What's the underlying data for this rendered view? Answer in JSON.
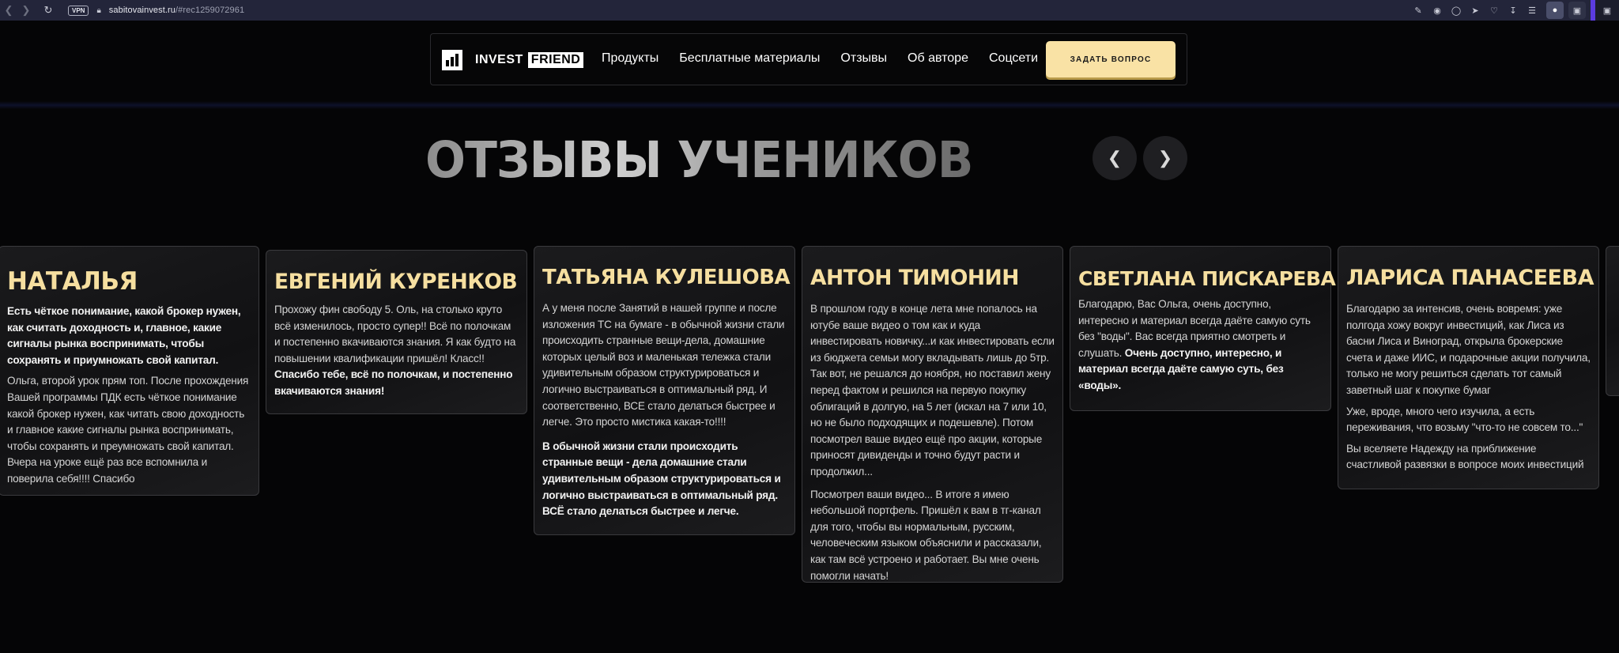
{
  "browser": {
    "vpn_label": "VPN",
    "url_host": "sabitovainvest.ru",
    "url_path": "/#rec1259072961"
  },
  "header": {
    "logo_text_1": "INVEST",
    "logo_text_2": "FRIEND",
    "nav": [
      "Продукты",
      "Бесплатные материалы",
      "Отзывы",
      "Об авторе",
      "Соцсети"
    ],
    "cta_label": "ЗАДАТЬ ВОПРОС"
  },
  "section": {
    "title": "ОТЗЫВЫ УЧЕНИКОВ"
  },
  "reviews": [
    {
      "name": "НАТАЛЬЯ",
      "paragraphs": [
        {
          "text": "Есть чёткое понимание, какой брокер нужен, как считать доходность и, главное, какие сигналы рынка воспринимать, чтобы сохранять и приумножать свой капитал.",
          "bold": true
        },
        {
          "text": "Ольга, второй урок прям топ. После прохождения Вашей программы ПДК есть чёткое понимание какой брокер нужен, как читать свою доходность и главное какие сигналы рынка воспринимать, чтобы сохранять и преумножать свой капитал. Вчера на уроке ещё раз все вспомнила и поверила себя!!!! Спасибо",
          "bold": false
        }
      ]
    },
    {
      "name": "ЕВГЕНИЙ КУРЕНКОВ",
      "paragraphs": [
        {
          "text": "Прохожу фин свободу 5. Оль, на столько круто всё изменилось, просто супер!! Всё по полочкам и постепенно вкачиваются знания. Я как будто на повышении квалификации пришёл! Класс!!",
          "bold": false
        },
        {
          "text": "Спасибо тебе, всё по полочкам, и постепенно вкачиваются знания!",
          "bold": true
        }
      ]
    },
    {
      "name": "ТАТЬЯНА КУЛЕШОВА",
      "paragraphs": [
        {
          "text": "А у меня после Занятий в нашей группе и после изложения ТС на бумаге - в обычной жизни стали происходить странные вещи-дела, домашние которых целый воз и маленькая тележка стали удивительным образом структурироваться и логично выстраиваться в оптимальный ряд. И соответственно, ВСЕ стало делаться быстрее и легче. Это просто мистика какая-то!!!!",
          "bold": false
        },
        {
          "text": "В обычной жизни стали происходить странные вещи - дела домашние стали удивительным образом структурироваться и логично выстраиваться в оптимальный ряд. ВСЁ стало делаться быстрее и легче.",
          "bold": true
        }
      ]
    },
    {
      "name": "АНТОН ТИМОНИН",
      "paragraphs": [
        {
          "text": "В прошлом году в конце лета мне попалось на ютубе ваше видео о том как и куда инвестировать новичку...и как инвестировать если из бюджета семьи могу вкладывать лишь до 5тр. Так вот, не решался до ноября, но поставил жену перед фактом и решился на первую покупку облигаций в долгую, на 5 лет (искал на 7 или 10, но не было подходящих и подешевле). Потом посмотрел ваше видео ещё про акции, которые приносят дивиденды и точно будут расти и продолжил...",
          "bold": false
        },
        {
          "text": "Посмотрел ваши видео... В итоге я имею небольшой портфель. Пришёл к вам в тг-канал для того, чтобы вы нормальным, русским, человеческим языком объяснили и рассказали, как там всё устроено и работает. Вы мне очень помогли начать!",
          "bold": false
        }
      ]
    },
    {
      "name": "СВЕТЛАНА ПИСКАРЕВА",
      "paragraphs": [
        {
          "text": "Благодарю, Вас Ольга, очень доступно, интересно и материал всегда даёте самую суть без \"воды\". Вас всегда приятно смотреть и слушать.",
          "bold": false,
          "tail_bold": "Очень доступно, интересно, и материал всегда даёте самую суть, без «воды»."
        }
      ]
    },
    {
      "name": "ЛАРИСА ПАНАСЕЕВА",
      "paragraphs": [
        {
          "text": "Благодарю за интенсив, очень вовремя: уже полгода хожу вокруг инвестиций, как Лиса из басни Лиса и Виноград, открыла брокерские счета и даже ИИС, и подарочные акции получила, только не могу решиться сделать тот самый заветный шаг к покупке бумаг",
          "bold": false
        },
        {
          "text": "Уже, вроде, много чего изучила, а есть переживания, что возьму \"что-то не совсем то...\"",
          "bold": false
        },
        {
          "text": "Вы вселяете Надежду на приближение счастливой развязки в вопросе моих инвестиций",
          "bold": false
        }
      ]
    }
  ]
}
